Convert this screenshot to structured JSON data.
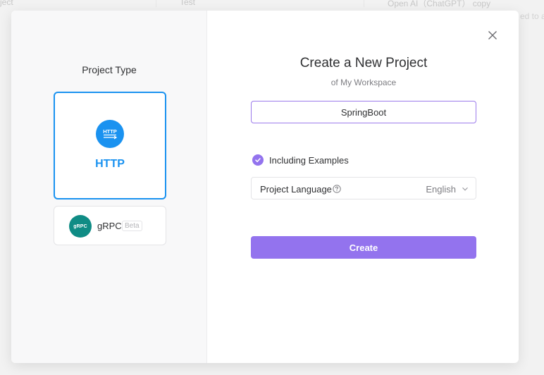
{
  "background": {
    "col1_text": "ject",
    "col2_text": "Test",
    "col3_text": "Open AI（ChatGPT） copy",
    "side_text": "ed to a"
  },
  "left_pane": {
    "title": "Project Type",
    "types": [
      {
        "label": "HTTP",
        "icon": "http-icon",
        "icon_text": "HTTP",
        "selected": true
      },
      {
        "label": "gRPC",
        "icon": "grpc-icon",
        "icon_text": "gRPC",
        "badge": "Beta",
        "selected": false
      }
    ]
  },
  "dialog": {
    "title": "Create a New Project",
    "subtitle": "of My Workspace",
    "project_name_value": "SpringBoot",
    "including_examples_label": "Including Examples",
    "including_examples_checked": true,
    "language_label": "Project Language",
    "language_value": "English",
    "create_label": "Create",
    "close_icon": "close-icon"
  },
  "colors": {
    "accent_purple": "#9373ee",
    "http_blue": "#1a92f0",
    "grpc_teal": "#0f8c85"
  }
}
